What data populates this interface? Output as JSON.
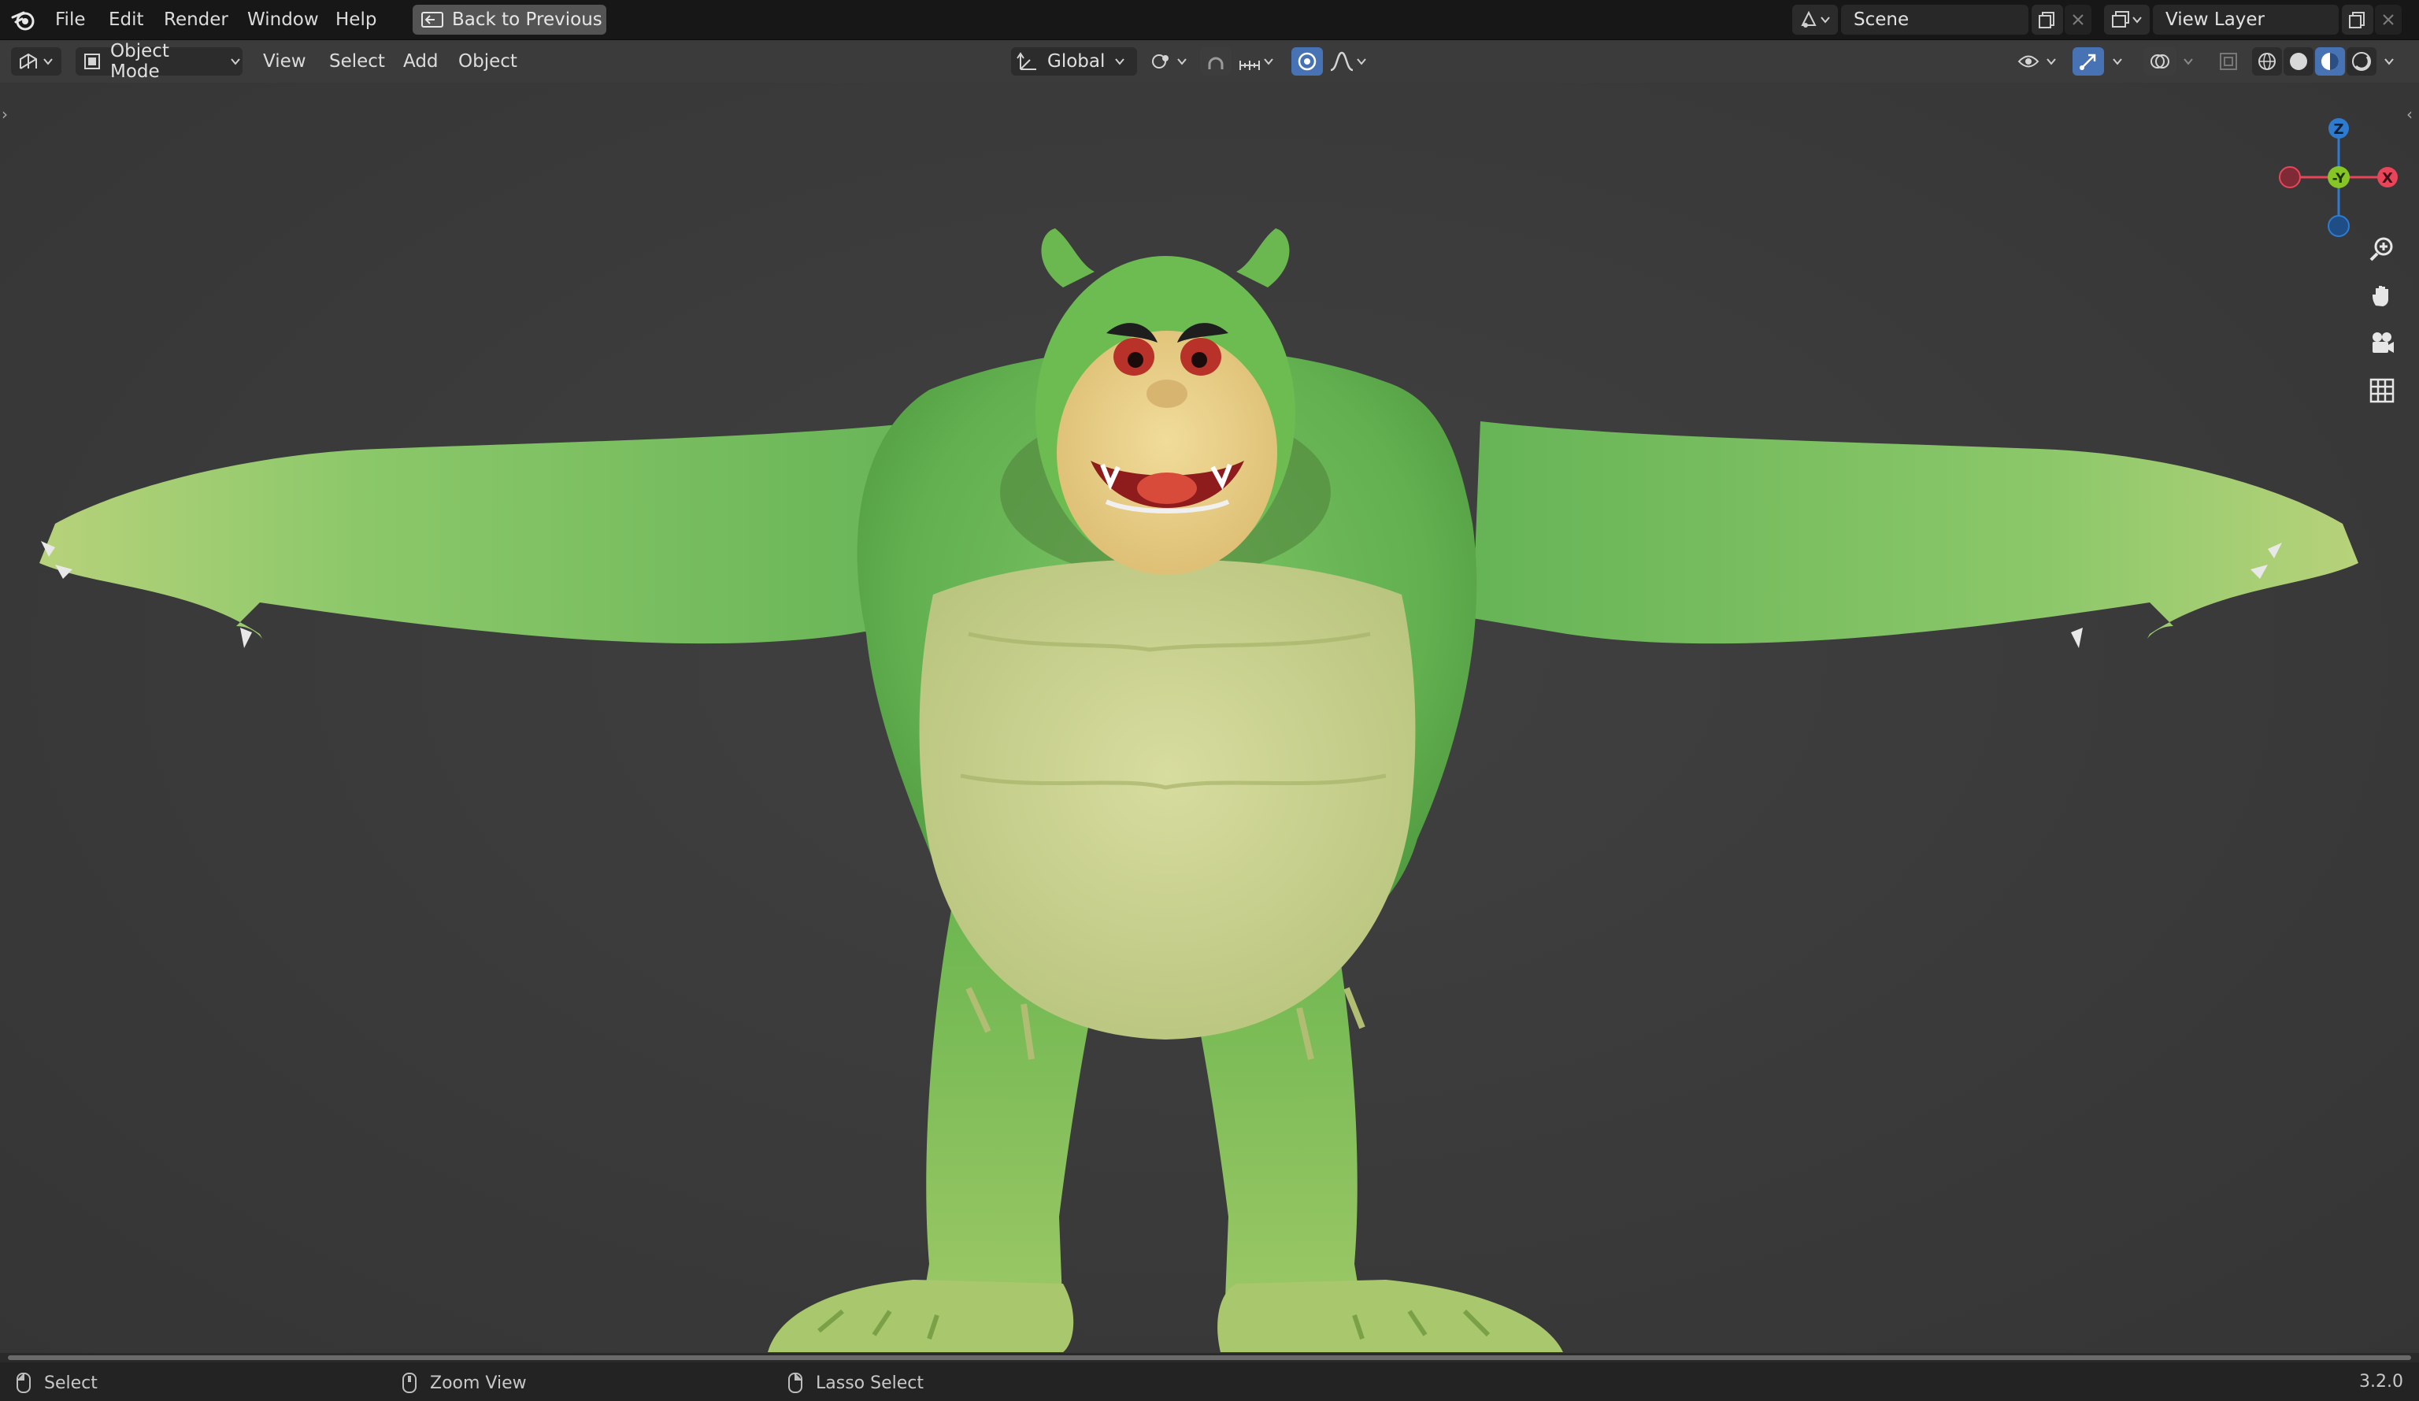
{
  "menu": {
    "items": [
      "File",
      "Edit",
      "Render",
      "Window",
      "Help"
    ],
    "back_button": "Back to Previous",
    "scene": "Scene",
    "view_layer": "View Layer"
  },
  "header": {
    "mode": "Object Mode",
    "menus": [
      "View",
      "Select",
      "Add",
      "Object"
    ],
    "orientation": "Global"
  },
  "gizmo": {
    "z": "Z",
    "y": "-Y",
    "x": "X"
  },
  "status": {
    "select": "Select",
    "zoom": "Zoom View",
    "lasso": "Lasso Select",
    "version": "3.2.0"
  },
  "colors": {
    "accent": "#4772b3",
    "axis_x": "#e8455a",
    "axis_y": "#86c526",
    "axis_z": "#2f7bd0",
    "skin_green": "#6cbc5a",
    "belly": "#c9d28f"
  },
  "icons": [
    "blender-logo-icon",
    "back-icon",
    "scene-icon",
    "new-scene-icon",
    "close-icon",
    "view-layer-icon",
    "editor-type-icon",
    "object-mode-icon",
    "transform-orientation-icon",
    "pivot-icon",
    "snap-icon",
    "proportional-edit-icon",
    "visibility-icon",
    "gizmo-icon",
    "overlay-icon",
    "xray-icon",
    "wireframe-shading-icon",
    "solid-shading-icon",
    "material-shading-icon",
    "rendered-shading-icon",
    "zoom-icon",
    "hand-icon",
    "camera-icon",
    "grid-icon",
    "mouse-left-icon",
    "mouse-middle-icon",
    "mouse-right-icon"
  ]
}
